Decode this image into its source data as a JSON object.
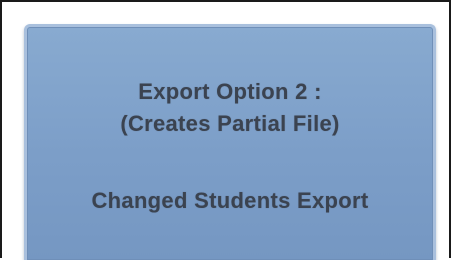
{
  "export_button": {
    "line1": "Export Option 2 :",
    "line2": "(Creates Partial File)",
    "line3": "Changed Students Export"
  },
  "colors": {
    "button_fill": "#7c9ec8",
    "button_border": "#a9c0dd",
    "text": "#3b4350",
    "frame_border": "#1a1a1a"
  }
}
